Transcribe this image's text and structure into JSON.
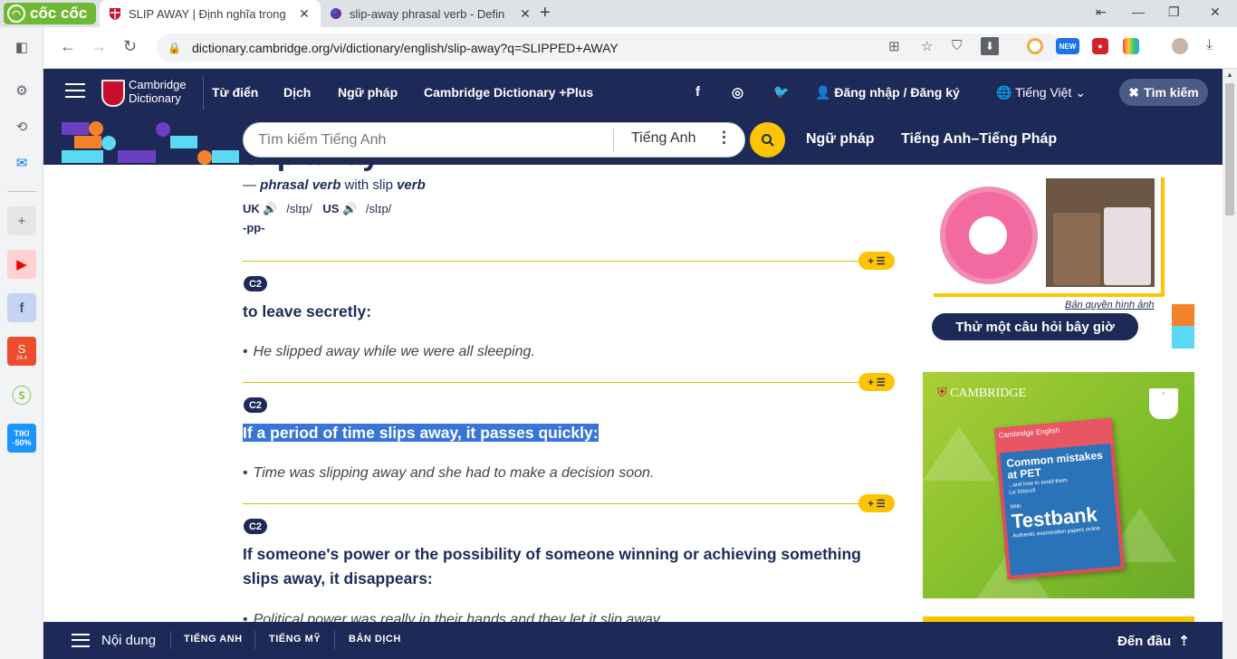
{
  "browser": {
    "brand": "cốc cốc",
    "tabs": [
      {
        "title": "SLIP AWAY | Định nghĩa trong",
        "active": true
      },
      {
        "title": "slip-away phrasal verb - Defin",
        "active": false
      }
    ],
    "url": "dictionary.cambridge.org/vi/dictionary/english/slip-away?q=SLIPPED+AWAY",
    "ext_new_badge": "NEW"
  },
  "sidebar": {
    "tiki_label": "TIKI\n-50%",
    "shopee_badge": "24.4"
  },
  "header": {
    "logo_line1": "Cambridge",
    "logo_line2": "Dictionary",
    "nav": [
      "Từ điển",
      "Dịch",
      "Ngữ pháp",
      "Cambridge Dictionary +Plus"
    ],
    "login": "Đăng nhập / Đăng ký",
    "language": "Tiếng Việt",
    "search_toggle": "Tìm kiếm"
  },
  "searchbar": {
    "placeholder": "Tìm kiếm Tiếng Anh",
    "dict_lang": "Tiếng Anh",
    "links": [
      "Ngữ pháp",
      "Tiếng Anh–Tiếng Pháp"
    ]
  },
  "entry": {
    "headword": "slip away",
    "pos_prefix": "— ",
    "pos": "phrasal verb",
    "with_text": " with slip ",
    "with_pos": "verb",
    "uk_label": "UK",
    "uk_ipa": "/slɪp/",
    "us_label": "US",
    "us_ipa": "/slɪp/",
    "grammar": "-pp-",
    "add_to_list": "+ ☰",
    "senses": [
      {
        "level": "C2",
        "definition": "to leave secretly:",
        "example": "He slipped away while we were all sleeping.",
        "selected": false
      },
      {
        "level": "C2",
        "definition": "If a period of time slips away, it passes quickly:",
        "example": "Time was slipping away and she had to make a decision soon.",
        "selected": true
      },
      {
        "level": "C2",
        "definition": "If someone's power or the possibility of someone winning or achieving something slips away, it disappears:",
        "example": "Political power was really in their hands and they let it slip away.",
        "selected": false
      }
    ]
  },
  "quiz": {
    "image_credit": "Bản quyền hình ảnh",
    "button": "Thử một câu hỏi bây giờ"
  },
  "ad": {
    "brand": "CAMBRIDGE",
    "book_header": "Cambridge English",
    "book_title": "Common mistakes at PET",
    "book_subtitle": "...and how to avoid them",
    "book_author": "Liz Driscoll",
    "book_with": "With",
    "book_testbank": "Testbank",
    "book_testbank_sub": "Authentic examination papers online"
  },
  "footer": {
    "contents": "Nội dung",
    "links": [
      "TIẾNG ANH",
      "TIẾNG MỸ",
      "BẢN DỊCH"
    ],
    "top": "Đến đầu"
  },
  "colors": {
    "navy": "#1d2a57",
    "yellow": "#fec400",
    "selection": "#3875d7"
  }
}
